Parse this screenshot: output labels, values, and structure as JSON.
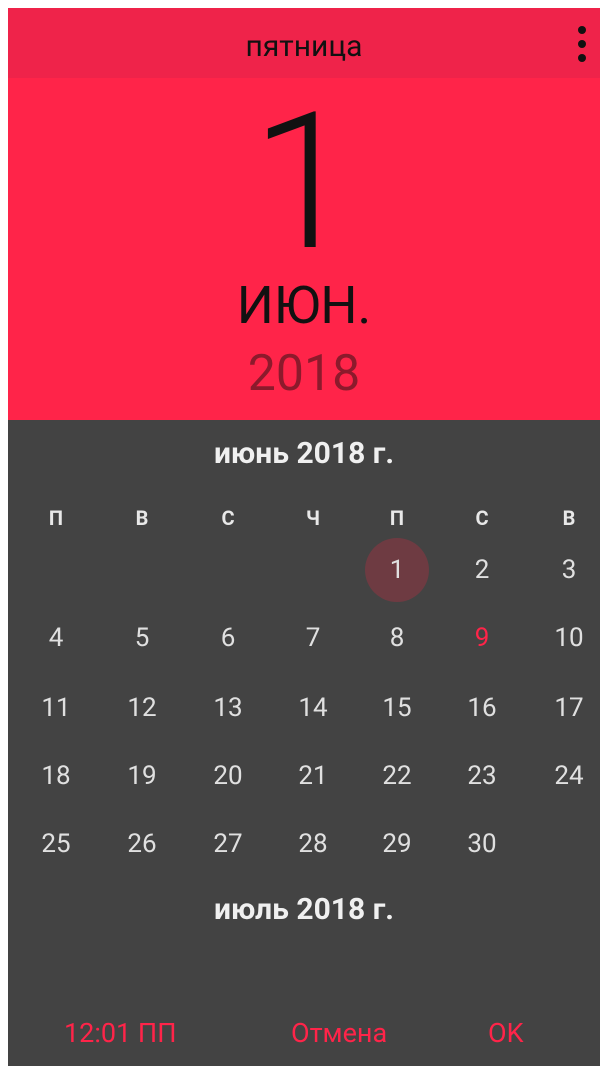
{
  "header": {
    "weekday": "пятница"
  },
  "hero": {
    "day": "1",
    "month": "ИЮН.",
    "year": "2018"
  },
  "calendar": {
    "month_title": "июнь 2018 г.",
    "next_month_title": "июль 2018 г.",
    "weekdays": [
      "П",
      "В",
      "С",
      "Ч",
      "П",
      "С",
      "В"
    ],
    "selected_day": "1",
    "today_day": "9",
    "weeks": [
      [
        "",
        "",
        "",
        "",
        "1",
        "2",
        "3"
      ],
      [
        "4",
        "5",
        "6",
        "7",
        "8",
        "9",
        "10"
      ],
      [
        "11",
        "12",
        "13",
        "14",
        "15",
        "16",
        "17"
      ],
      [
        "18",
        "19",
        "20",
        "21",
        "22",
        "23",
        "24"
      ],
      [
        "25",
        "26",
        "27",
        "28",
        "29",
        "30",
        ""
      ]
    ]
  },
  "actions": {
    "time": "12:01 ПП",
    "cancel": "Отмена",
    "ok": "OK"
  },
  "colors": {
    "accent": "#ff2449",
    "header": "#ef234a",
    "background": "#434343",
    "selected": "#6e3b42",
    "year": "#8c1a2c"
  }
}
